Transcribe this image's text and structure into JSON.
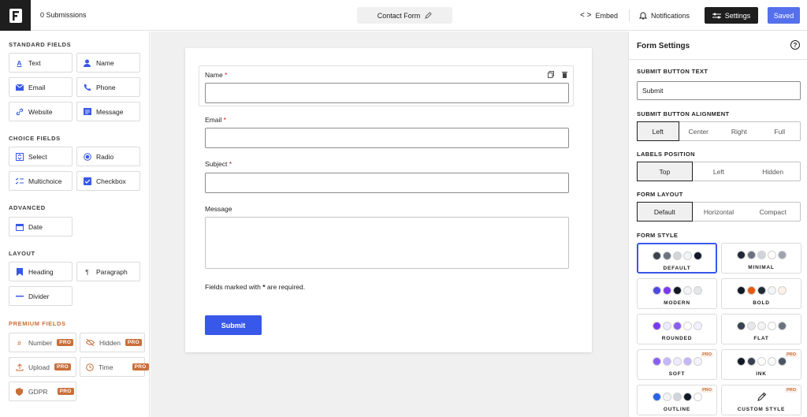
{
  "header": {
    "submissions": "0  Submissions",
    "form_title": "Contact Form",
    "embed": "Embed",
    "notifications": "Notifications",
    "settings": "Settings",
    "saved": "Saved"
  },
  "sidebar": {
    "standard_title": "STANDARD FIELDS",
    "standard": [
      {
        "label": "Text",
        "icon": "text-icon"
      },
      {
        "label": "Name",
        "icon": "user-icon"
      },
      {
        "label": "Email",
        "icon": "mail-icon"
      },
      {
        "label": "Phone",
        "icon": "phone-icon"
      },
      {
        "label": "Website",
        "icon": "link-icon"
      },
      {
        "label": "Message",
        "icon": "message-icon"
      }
    ],
    "choice_title": "CHOICE FIELDS",
    "choice": [
      {
        "label": "Select",
        "icon": "select-icon"
      },
      {
        "label": "Radio",
        "icon": "radio-icon"
      },
      {
        "label": "Multichoice",
        "icon": "multichoice-icon"
      },
      {
        "label": "Checkbox",
        "icon": "checkbox-icon"
      }
    ],
    "advanced_title": "ADVANCED",
    "advanced": [
      {
        "label": "Date",
        "icon": "calendar-icon"
      }
    ],
    "layout_title": "LAYOUT",
    "layout": [
      {
        "label": "Heading",
        "icon": "bookmark-icon"
      },
      {
        "label": "Paragraph",
        "icon": "pilcrow-icon"
      },
      {
        "label": "Divider",
        "icon": "divider-icon"
      }
    ],
    "premium_title": "PREMIUM FIELDS",
    "premium": [
      {
        "label": "Number",
        "icon": "hash-icon",
        "badge": "PRO"
      },
      {
        "label": "Hidden",
        "icon": "eye-off-icon",
        "badge": "PRO"
      },
      {
        "label": "Upload",
        "icon": "upload-icon",
        "badge": "PRO"
      },
      {
        "label": "Time",
        "icon": "clock-icon",
        "badge": "PRO"
      },
      {
        "label": "GDPR",
        "icon": "shield-icon",
        "badge": "PRO"
      }
    ]
  },
  "form": {
    "fields": [
      {
        "label": "Name",
        "required": "*"
      },
      {
        "label": "Email",
        "required": "*"
      },
      {
        "label": "Subject",
        "required": "*"
      },
      {
        "label": "Message",
        "required": ""
      }
    ],
    "note_prefix": "Fields marked with ",
    "note_star": "*",
    "note_suffix": " are required.",
    "submit": "Submit"
  },
  "settings_panel": {
    "title": "Form Settings",
    "submit_text_label": "SUBMIT BUTTON TEXT",
    "submit_text_value": "Submit",
    "alignment_label": "SUBMIT BUTTON ALIGNMENT",
    "alignment": [
      "Left",
      "Center",
      "Right",
      "Full"
    ],
    "alignment_selected": "Left",
    "labels_label": "LABELS POSITION",
    "labels": [
      "Top",
      "Left",
      "Hidden"
    ],
    "labels_selected": "Top",
    "layout_label": "FORM LAYOUT",
    "layouts": [
      "Default",
      "Horizontal",
      "Compact"
    ],
    "layout_selected": "Default",
    "style_label": "FORM STYLE",
    "styles": [
      {
        "name": "DEFAULT",
        "colors": [
          "#3c4350",
          "#6b7280",
          "#d1d5db",
          "#f3f4f6",
          "#111827"
        ],
        "pro": ""
      },
      {
        "name": "MINIMAL",
        "colors": [
          "#1f2937",
          "#6b7280",
          "#d1d5db",
          "#ffffff",
          "#9ca3af"
        ],
        "pro": ""
      },
      {
        "name": "MODERN",
        "colors": [
          "#4f46e5",
          "#7c3aed",
          "#111827",
          "#f3f4f6",
          "#e5e7eb"
        ],
        "pro": ""
      },
      {
        "name": "BOLD",
        "colors": [
          "#111827",
          "#ea580c",
          "#1f2937",
          "#f3f4f6",
          "#fff1e6"
        ],
        "pro": ""
      },
      {
        "name": "ROUNDED",
        "colors": [
          "#7c3aed",
          "#ede9fe",
          "#8b5cf6",
          "#ffffff",
          "#f3f0ff"
        ],
        "pro": ""
      },
      {
        "name": "FLAT",
        "colors": [
          "#374151",
          "#e5e7eb",
          "#f3f4f6",
          "#ffffff",
          "#6b7280"
        ],
        "pro": ""
      },
      {
        "name": "SOFT",
        "colors": [
          "#8b5cf6",
          "#c4b5fd",
          "#ede9fe",
          "#c4b5fd",
          "#f5f3ff"
        ],
        "pro": "PRO"
      },
      {
        "name": "INK",
        "colors": [
          "#111827",
          "#374151",
          "#ffffff",
          "#f9fafb",
          "#4b5563"
        ],
        "pro": "PRO"
      },
      {
        "name": "OUTLINE",
        "colors": [
          "#2563eb",
          "#f3f4f6",
          "#d1d5db",
          "#111827",
          "#ffffff"
        ],
        "pro": "PRO"
      },
      {
        "name": "CUSTOM STYLE",
        "colors": [],
        "pro": "PRO"
      }
    ]
  }
}
